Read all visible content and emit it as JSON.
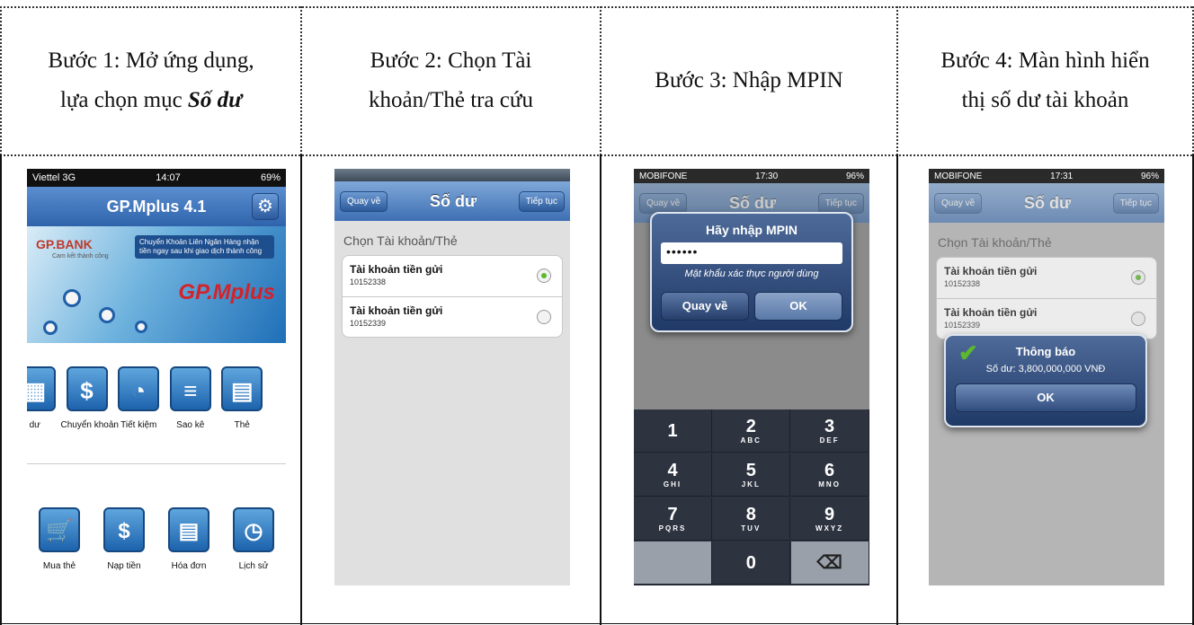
{
  "headers": {
    "step1_prefix": "Bước 1: Mở ứng dụng,",
    "step1_line2": "lựa chọn mục ",
    "step1_bold": "Số dư",
    "step2_line1": "Bước 2: Chọn Tài",
    "step2_line2": "khoản/Thẻ tra cứu",
    "step3": "Bước 3: Nhập MPIN",
    "step4_line1": "Bước 4: Màn hình hiển",
    "step4_line2": "thị số dư tài khoản"
  },
  "phone1": {
    "carrier": "Viettel 3G",
    "time": "14:07",
    "battery": "69%",
    "app_title": "GP.Mplus 4.1",
    "bank_name": "GP.BANK",
    "slogan": "Cam kết thành công",
    "promo_text": "Chuyển Khoản Liên Ngân Hàng nhận tiền ngay sau khi giao dịch thành công",
    "brand": "GP.Mplus",
    "row1": [
      "dư",
      "Chuyển khoản",
      "Tiết kiệm",
      "Sao kê",
      "Thẻ"
    ],
    "row2": [
      "Mua thẻ",
      "Nạp tiền",
      "Hóa đơn",
      "Lịch sử"
    ]
  },
  "balance_screen": {
    "title": "Số dư",
    "back": "Quay về",
    "next": "Tiếp tục",
    "choose_label": "Chọn Tài khoản/Thẻ",
    "accounts": [
      {
        "name": "Tài khoản tiền gửi",
        "number": "10152338"
      },
      {
        "name": "Tài khoản tiền gửi",
        "number": "10152339"
      }
    ]
  },
  "phone3": {
    "carrier": "MOBIFONE",
    "time": "17:30",
    "battery": "96%",
    "dialog_title": "Hãy nhập MPIN",
    "password_mask": "••••••",
    "hint": "Mật khẩu xác thực người dùng",
    "cancel": "Quay về",
    "ok": "OK",
    "keys": [
      {
        "d": "1",
        "l": ""
      },
      {
        "d": "2",
        "l": "ABC"
      },
      {
        "d": "3",
        "l": "DEF"
      },
      {
        "d": "4",
        "l": "GHI"
      },
      {
        "d": "5",
        "l": "JKL"
      },
      {
        "d": "6",
        "l": "MNO"
      },
      {
        "d": "7",
        "l": "PQRS"
      },
      {
        "d": "8",
        "l": "TUV"
      },
      {
        "d": "9",
        "l": "WXYZ"
      },
      {
        "d": "",
        "l": ""
      },
      {
        "d": "0",
        "l": ""
      },
      {
        "d": "⌫",
        "l": ""
      }
    ]
  },
  "phone4": {
    "carrier": "MOBIFONE",
    "time": "17:31",
    "battery": "96%",
    "notice_title": "Thông báo",
    "notice_text": "Số dư: 3,800,000,000 VNĐ",
    "ok": "OK"
  },
  "colors": {
    "nav_blue": "#3d6fb3",
    "check_green": "#5cb82f",
    "dialog_blue": "#2b4a7d"
  }
}
